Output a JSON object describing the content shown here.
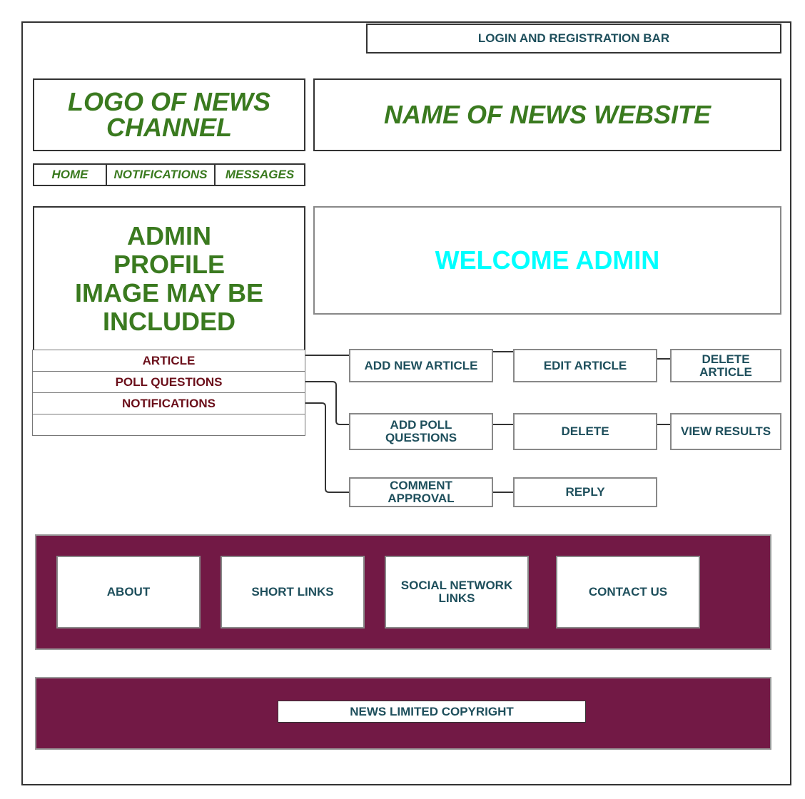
{
  "login_bar": "LOGIN AND REGISTRATION BAR",
  "logo": "LOGO OF NEWS CHANNEL",
  "site_name": "NAME OF NEWS WEBSITE",
  "nav": [
    "HOME",
    "NOTIFICATIONS",
    "MESSAGES"
  ],
  "profile_image": "ADMIN PROFILE IMAGE MAY BE INCLUDED",
  "welcome": "WELCOME ADMIN",
  "menu": [
    "ARTICLE",
    "POLL QUESTIONS",
    "NOTIFICATIONS",
    ""
  ],
  "article_actions": [
    "ADD NEW ARTICLE",
    "EDIT ARTICLE",
    "DELETE ARTICLE"
  ],
  "poll_actions": [
    "ADD POLL QUESTIONS",
    "DELETE",
    "VIEW RESULTS"
  ],
  "notification_actions": [
    "COMMENT APPROVAL",
    "REPLY"
  ],
  "footer_links": [
    "ABOUT",
    "SHORT LINKS",
    "SOCIAL NETWORK LINKS",
    "CONTACT US"
  ],
  "copyright": "NEWS LIMITED COPYRIGHT",
  "colors": {
    "band": "#721945",
    "heading_green": "#3a7a1f",
    "welcome_cyan": "#00ffff",
    "teal_text": "#1e4f5c",
    "menu_text": "#6b0f1a"
  }
}
